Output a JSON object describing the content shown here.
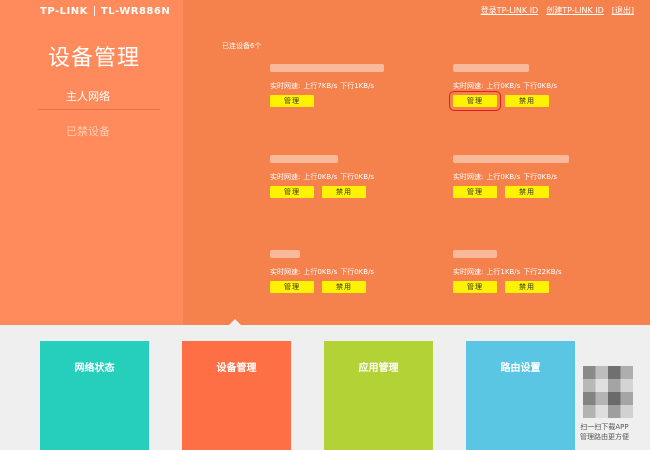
{
  "header": {
    "brand": "TP-LINK",
    "model": "TL-WR886N",
    "links": {
      "login": "登录TP-LINK ID",
      "create": "创建TP-LINK ID",
      "logout": "[退出]"
    }
  },
  "sidebar": {
    "title": "设备管理",
    "items": [
      {
        "label": "主人网络"
      },
      {
        "label": "已禁设备"
      }
    ]
  },
  "main": {
    "connected_label": "已连设备6个",
    "speed_label": "实时网速:",
    "devices": [
      {
        "up": "上行7KB/s",
        "down": "下行1KB/s"
      },
      {
        "up": "上行0KB/s",
        "down": "下行0KB/s"
      },
      {
        "up": "上行0KB/s",
        "down": "下行0KB/s"
      },
      {
        "up": "上行0KB/s",
        "down": "下行0KB/s"
      },
      {
        "up": "上行0KB/s",
        "down": "下行0KB/s"
      },
      {
        "up": "上行1KB/s",
        "down": "下行22KB/s"
      }
    ],
    "manage_label": "管理",
    "disable_label": "禁用"
  },
  "tiles": [
    {
      "label": "网络状态",
      "color": "#26cfbb"
    },
    {
      "label": "设备管理",
      "color": "#ff6f45"
    },
    {
      "label": "应用管理",
      "color": "#b2d235"
    },
    {
      "label": "路由设置",
      "color": "#5bc5e4"
    }
  ],
  "qr": {
    "line1": "扫一扫下载APP",
    "line2": "管理路由更方便"
  }
}
